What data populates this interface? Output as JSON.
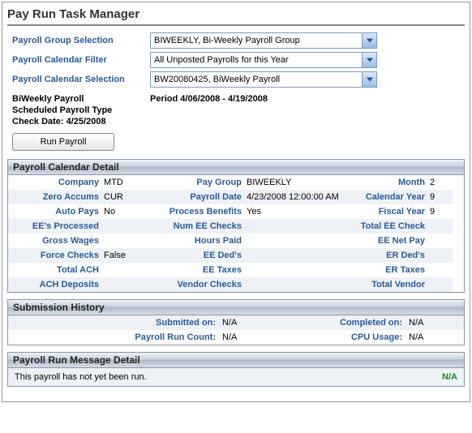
{
  "pageTitle": "Pay Run Task Manager",
  "selectors": {
    "payrollGroupLabel": "Payroll Group Selection",
    "payrollGroupValue": "BIWEEKLY, Bi-Weekly Payroll Group",
    "calendarFilterLabel": "Payroll Calendar Filter",
    "calendarFilterValue": "All Unposted Payrolls for this Year",
    "calendarSelectionLabel": "Payroll Calendar Selection",
    "calendarSelectionValue": "BW20080425, BiWeekly Payroll"
  },
  "info": {
    "payrollName": "BiWeekly Payroll",
    "scheduledType": "Scheduled Payroll Type",
    "checkDate": "Check Date: 4/25/2008",
    "period": "Period 4/06/2008 - 4/19/2008"
  },
  "runButton": "Run Payroll",
  "detail": {
    "header": "Payroll Calendar Detail",
    "rows": [
      {
        "l1": "Company",
        "v1": "MTD",
        "l2": "Pay Group",
        "v2": "BIWEEKLY",
        "l3": "Month",
        "v3": "2"
      },
      {
        "l1": "Zero Accums",
        "v1": "CUR",
        "l2": "Payroll Date",
        "v2": "4/23/2008 12:00:00 AM",
        "l3": "Calendar Year",
        "v3": "9"
      },
      {
        "l1": "Auto Pays",
        "v1": "No",
        "l2": "Process Benefits",
        "v2": "Yes",
        "l3": "Fiscal Year",
        "v3": "9"
      },
      {
        "l1": "EE's Processed",
        "v1": "",
        "l2": "Num EE Checks",
        "v2": "",
        "l3": "Total EE Check",
        "v3": ""
      },
      {
        "l1": "Gross Wages",
        "v1": "",
        "l2": "Hours Paid",
        "v2": "",
        "l3": "EE Net Pay",
        "v3": ""
      },
      {
        "l1": "Force Checks",
        "v1": "False",
        "l2": "EE Ded's",
        "v2": "",
        "l3": "ER Ded's",
        "v3": ""
      },
      {
        "l1": "Total ACH",
        "v1": "",
        "l2": "EE Taxes",
        "v2": "",
        "l3": "ER Taxes",
        "v3": ""
      },
      {
        "l1": "ACH Deposits",
        "v1": "",
        "l2": "Vendor Checks",
        "v2": "",
        "l3": "Total Vendor",
        "v3": ""
      }
    ]
  },
  "submission": {
    "header": "Submission History",
    "submittedOnLabel": "Submitted on:",
    "submittedOnValue": "N/A",
    "completedOnLabel": "Completed on:",
    "completedOnValue": "N/A",
    "runCountLabel": "Payroll Run Count:",
    "runCountValue": "N/A",
    "cpuLabel": "CPU Usage:",
    "cpuValue": "N/A"
  },
  "message": {
    "header": "Payroll Run Message Detail",
    "text": "This payroll has not yet been run.",
    "status": "N/A"
  }
}
